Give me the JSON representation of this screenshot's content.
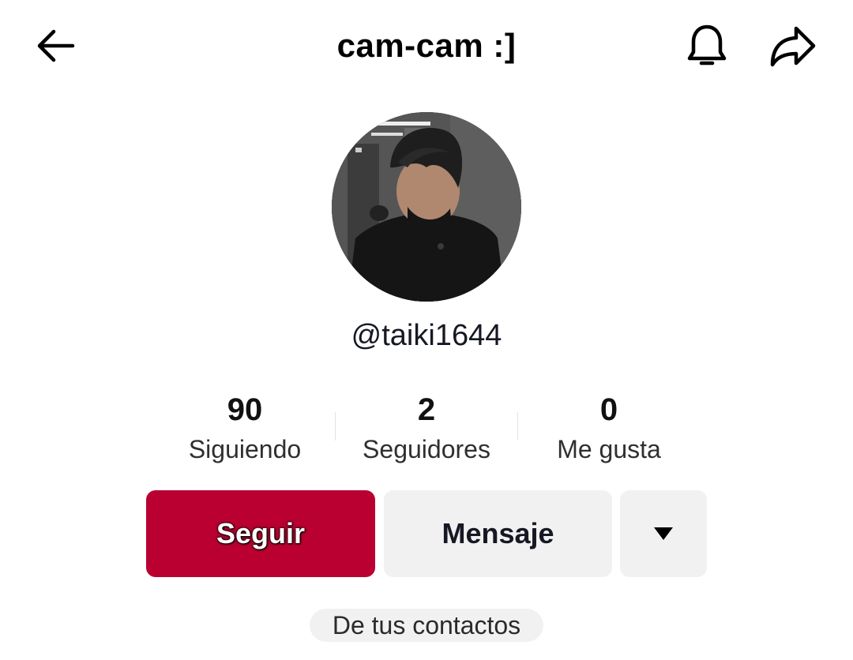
{
  "header": {
    "title": "cam-cam :]",
    "back_icon": "arrow-left-icon",
    "notification_icon": "bell-icon",
    "share_icon": "share-arrow-icon"
  },
  "profile": {
    "avatar_icon": "profile-photo",
    "username": "@taiki1644"
  },
  "stats": {
    "following": {
      "value": "90",
      "label": "Siguiendo"
    },
    "followers": {
      "value": "2",
      "label": "Seguidores"
    },
    "likes": {
      "value": "0",
      "label": "Me gusta"
    }
  },
  "actions": {
    "follow_label": "Seguir",
    "message_label": "Mensaje",
    "more_icon": "caret-down-icon"
  },
  "badge": {
    "label": "De tus contactos"
  },
  "colors": {
    "follow_button": "#b90030",
    "secondary_button": "#f1f1f2",
    "text_primary": "#161823"
  }
}
